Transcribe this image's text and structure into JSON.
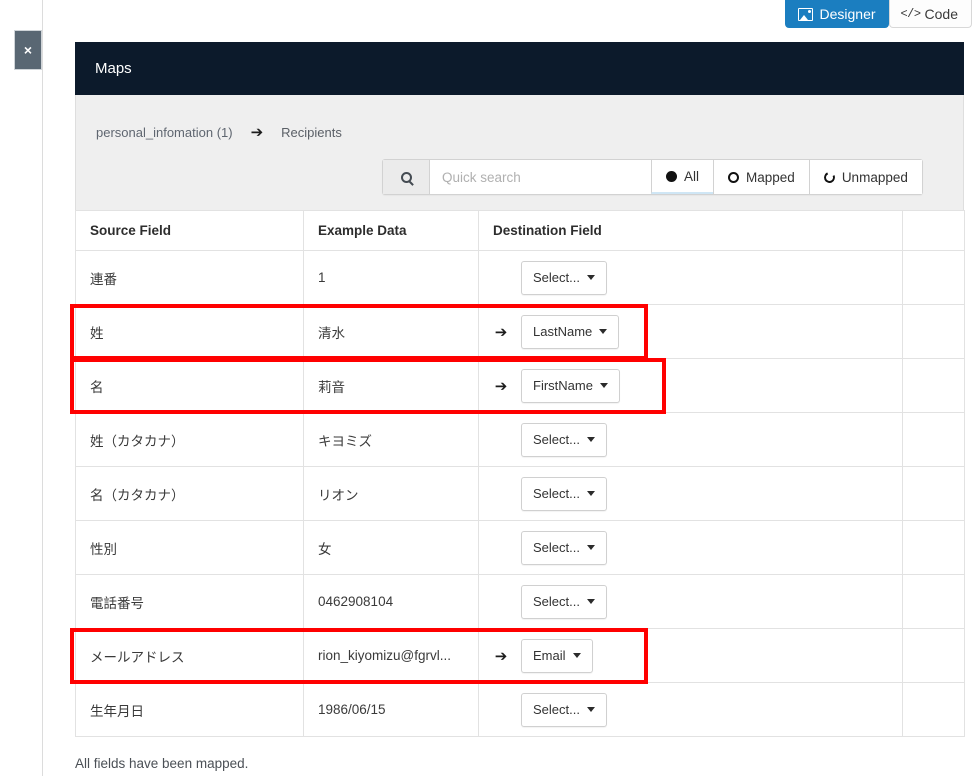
{
  "tabs": [
    {
      "label": "Designer",
      "icon": "image-icon",
      "active": true
    },
    {
      "label": "Code",
      "icon": "code-icon",
      "active": false
    }
  ],
  "close_button": {
    "glyph": "×",
    "name": "close-panel-button"
  },
  "panel": {
    "title": "Maps",
    "breadcrumb": {
      "source": "personal_infomation (1)",
      "arrow": "➔",
      "destination": "Recipients"
    },
    "search": {
      "placeholder": "Quick search",
      "value": "",
      "icon": "search-icon"
    },
    "filters": [
      {
        "label": "All",
        "marker": "dot-filled",
        "selected": true
      },
      {
        "label": "Mapped",
        "marker": "dot-hollow",
        "selected": false
      },
      {
        "label": "Unmapped",
        "marker": "dot-broken",
        "selected": false
      }
    ]
  },
  "table": {
    "headers": [
      "Source Field",
      "Example Data",
      "Destination Field"
    ],
    "rows": [
      {
        "source": "連番",
        "example": "1",
        "destination": "Select...",
        "mapped": false,
        "highlighted": false
      },
      {
        "source": "姓",
        "example": "清水",
        "destination": "LastName",
        "mapped": true,
        "highlighted": true
      },
      {
        "source": "名",
        "example": "莉音",
        "destination": "FirstName",
        "mapped": true,
        "highlighted": true
      },
      {
        "source": "姓（カタカナ）",
        "example": "キヨミズ",
        "destination": "Select...",
        "mapped": false,
        "highlighted": false
      },
      {
        "source": "名（カタカナ）",
        "example": "リオン",
        "destination": "Select...",
        "mapped": false,
        "highlighted": false
      },
      {
        "source": "性別",
        "example": "女",
        "destination": "Select...",
        "mapped": false,
        "highlighted": false
      },
      {
        "source": "電話番号",
        "example": "0462908104",
        "destination": "Select...",
        "mapped": false,
        "highlighted": false
      },
      {
        "source": "メールアドレス",
        "example": "rion_kiyomizu@fgrvl...",
        "destination": "Email",
        "mapped": true,
        "highlighted": true
      },
      {
        "source": "生年月日",
        "example": "1986/06/15",
        "destination": "Select...",
        "mapped": false,
        "highlighted": false
      }
    ],
    "map_arrow": "➔"
  },
  "footer": {
    "message": "All fields have been mapped."
  },
  "colors": {
    "tab_active": "#1b7ec0",
    "panel_header": "#0c1a2b",
    "annotation": "#ff0000",
    "toolbar_bg": "#efefef",
    "close_btn": "#596773"
  }
}
